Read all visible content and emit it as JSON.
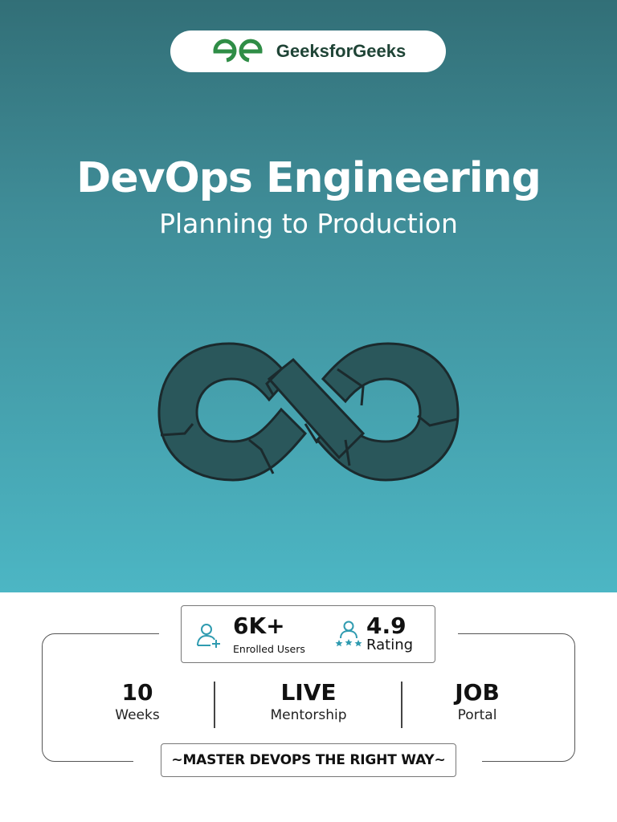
{
  "brand": {
    "name": "GeeksforGeeks",
    "color": "#2f8d46"
  },
  "hero": {
    "title": "DevOps Engineering",
    "subtitle": "Planning to Production",
    "gradient_top": "#326f77",
    "gradient_bottom": "#4cb6c4",
    "illustration": "devops-infinity-loop"
  },
  "stats": [
    {
      "value": "6K+",
      "label": "Enrolled Users",
      "icon": "user-plus-icon"
    },
    {
      "value": "4.9",
      "label": "Rating",
      "icon": "user-stars-icon"
    }
  ],
  "features": [
    {
      "value": "10",
      "label": "Weeks"
    },
    {
      "value": "LIVE",
      "label": "Mentorship"
    },
    {
      "value": "JOB",
      "label": "Portal"
    }
  ],
  "motto": "~MASTER DEVOPS THE RIGHT WAY~"
}
